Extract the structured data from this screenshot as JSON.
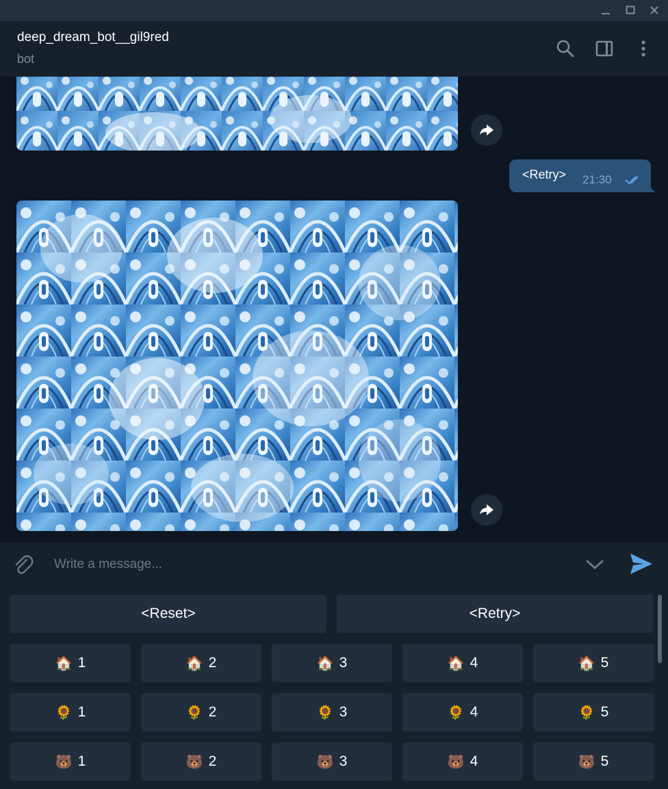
{
  "window": {
    "controls": [
      "minimize-icon",
      "maximize-icon",
      "close-icon"
    ]
  },
  "header": {
    "title": "deep_dream_bot__gil9red",
    "subtitle": "bot",
    "icons": [
      "search-icon",
      "sidebar-toggle-icon",
      "more-vertical-icon"
    ]
  },
  "messages": {
    "outgoing": {
      "text": "<Retry>",
      "time": "21:30",
      "status": "read"
    }
  },
  "composer": {
    "placeholder": "Write a message..."
  },
  "keyboard": {
    "top_row": [
      {
        "label": "<Reset>"
      },
      {
        "label": "<Retry>"
      }
    ],
    "rows": [
      [
        {
          "emoji": "🏠",
          "label": "1"
        },
        {
          "emoji": "🏠",
          "label": "2"
        },
        {
          "emoji": "🏠",
          "label": "3"
        },
        {
          "emoji": "🏠",
          "label": "4"
        },
        {
          "emoji": "🏠",
          "label": "5"
        }
      ],
      [
        {
          "emoji": "🌻",
          "label": "1"
        },
        {
          "emoji": "🌻",
          "label": "2"
        },
        {
          "emoji": "🌻",
          "label": "3"
        },
        {
          "emoji": "🌻",
          "label": "4"
        },
        {
          "emoji": "🌻",
          "label": "5"
        }
      ],
      [
        {
          "emoji": "🐻",
          "label": "1"
        },
        {
          "emoji": "🐻",
          "label": "2"
        },
        {
          "emoji": "🐻",
          "label": "3"
        },
        {
          "emoji": "🐻",
          "label": "4"
        },
        {
          "emoji": "🐻",
          "label": "5"
        }
      ]
    ]
  },
  "colors": {
    "background": "#0e1621",
    "header": "#17212b",
    "bubble": "#2b5278",
    "accent": "#5aa3e6",
    "keyboard_button": "#232e3c"
  }
}
